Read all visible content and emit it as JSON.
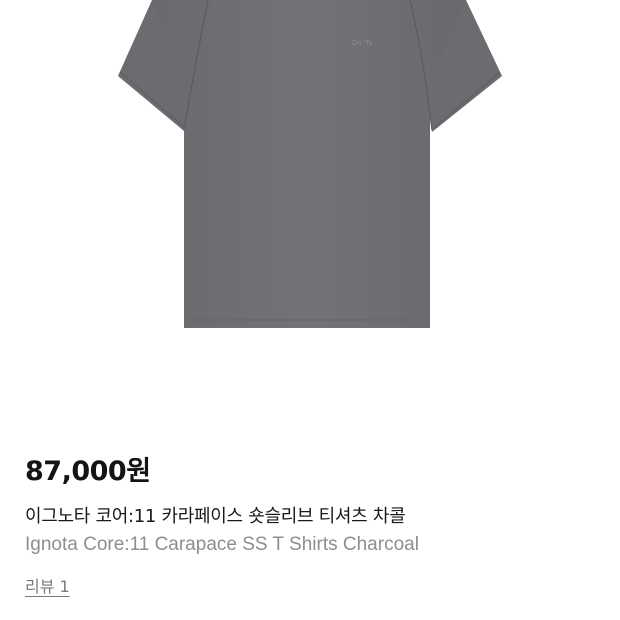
{
  "product": {
    "image_alt_icon": "tshirt-photo",
    "shirt_color": "#6e6e72",
    "price": "87,000원",
    "name_ko": "이그노타 코어:11 카라페이스 숏슬리브 티셔츠 차콜",
    "name_en": "Ignota Core:11 Carapace SS T Shirts Charcoal",
    "review_link": "리뷰 1"
  }
}
